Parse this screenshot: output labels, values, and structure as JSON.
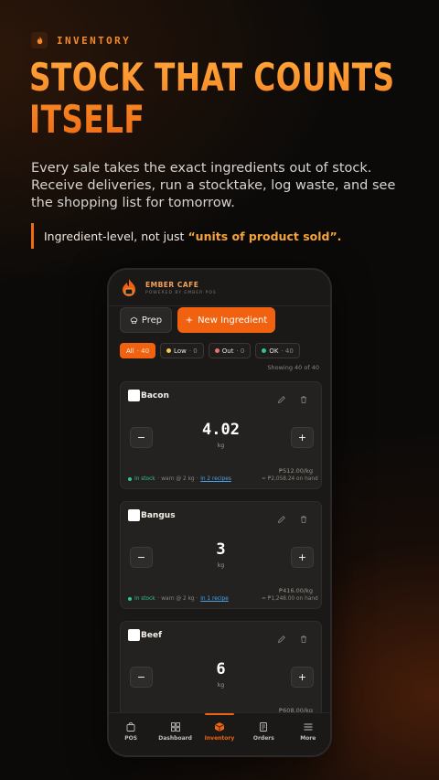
{
  "hero": {
    "eyebrow": "INVENTORY",
    "headline": "STOCK THAT COUNTS ITSELF",
    "subtitle": "Every sale takes the exact ingredients out of stock. Receive deliveries, run a stocktake, log waste, and see the shopping list for tomorrow.",
    "callout_prefix": "Ingredient-level, not just",
    "callout_highlight": "“units of product sold”."
  },
  "app": {
    "brand": "EMBER CAFE",
    "brand_sub": "POWERED BY EMBER POS",
    "prep_label": "Prep",
    "new_label": "New Ingredient",
    "filters": [
      {
        "label": "All",
        "count": "· 40",
        "active": true
      },
      {
        "label": "Low",
        "count": "· 0",
        "color": "#f2c94c"
      },
      {
        "label": "Out",
        "count": "· 0",
        "color": "#e5736f"
      },
      {
        "label": "OK",
        "count": "· 40",
        "color": "#33c48a"
      }
    ],
    "showing": "Showing 40 of 40",
    "ingredients": [
      {
        "name": "Bacon",
        "qty": "4.02",
        "unit": "kg",
        "price": "₱512.00/kg",
        "status": "In stock",
        "warn": "· warn @ 2 kg ·",
        "recipes": "in 2 recipes",
        "onhand": "≈ ₱2,058.24 on hand"
      },
      {
        "name": "Bangus",
        "qty": "3",
        "unit": "kg",
        "price": "₱416.00/kg",
        "status": "In stock",
        "warn": "· warn @ 2 kg ·",
        "recipes": "in 1 recipe",
        "onhand": "≈ ₱1,248.00 on hand"
      },
      {
        "name": "Beef",
        "qty": "6",
        "unit": "kg",
        "price": "₱608.00/kg",
        "status": "",
        "warn": "",
        "recipes": "",
        "onhand": ""
      }
    ],
    "nav": [
      {
        "label": "POS",
        "icon": "bag-icon"
      },
      {
        "label": "Dashboard",
        "icon": "grid-icon"
      },
      {
        "label": "Inventory",
        "icon": "box-icon",
        "active": true
      },
      {
        "label": "Orders",
        "icon": "receipt-icon"
      },
      {
        "label": "More",
        "icon": "menu-icon"
      }
    ]
  },
  "colors": {
    "accent": "#f0620f",
    "ok": "#33c48a",
    "low": "#f2c94c",
    "out": "#e5736f",
    "link": "#4aa3e8"
  }
}
